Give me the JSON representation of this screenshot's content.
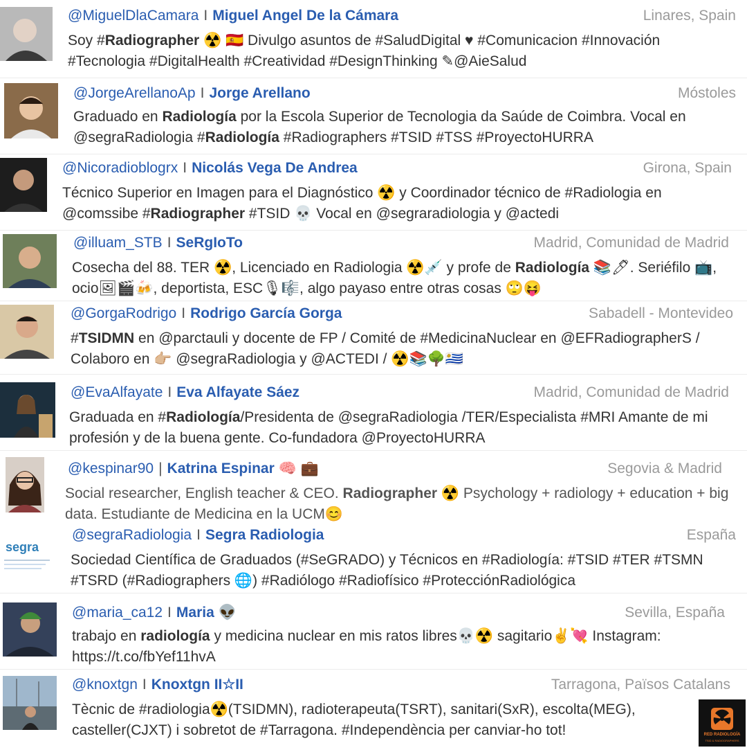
{
  "profiles": [
    {
      "handle": "@MiguelDlaCamara",
      "sep": "I",
      "name": "Miguel Angel De la Cámara",
      "name_suffix": "",
      "location": "Linares, Spain",
      "bio": [
        {
          "t": "Soy #"
        },
        {
          "b": "Radiographer"
        },
        {
          "t": " ☢️ 🇪🇸 Divulgo asuntos de #SaludDigital ♥ #Comunicacion #Innovación #Tecnologia #DigitalHealth #Creatividad #DesignThinking ✎@AieSalud"
        }
      ]
    },
    {
      "handle": "@JorgeArellanoAp",
      "sep": "I",
      "name": "Jorge Arellano",
      "name_suffix": "",
      "location": "Móstoles",
      "bio": [
        {
          "t": "Graduado en "
        },
        {
          "b": "Radiología"
        },
        {
          "t": " por la Escola Superior de Tecnologia da Saúde de Coimbra. Vocal en @segraRadiologia #"
        },
        {
          "b": "Radiología"
        },
        {
          "t": " #Radiographers #TSID #TSS #ProyectoHURRA"
        }
      ]
    },
    {
      "handle": "@Nicoradioblogrx",
      "sep": "I",
      "name": "Nicolás Vega De Andrea",
      "name_suffix": "",
      "location": "Girona, Spain",
      "bio": [
        {
          "t": "Técnico Superior en Imagen para el Diagnóstico ☢️ y Coordinador técnico de #Radiologia en @comssibe #"
        },
        {
          "b": "Radiographer"
        },
        {
          "t": " #TSID 💀 Vocal en @segraradiologia y @actedi"
        }
      ]
    },
    {
      "handle": "@illuam_STB",
      "sep": "I",
      "name": "SeRgIoTo",
      "name_suffix": "",
      "location": "Madrid, Comunidad de Madrid",
      "bio": [
        {
          "t": "Cosecha del 88. TER ☢️, Licenciado en Radiologia ☢️💉 y profe de "
        },
        {
          "b": "Radiología"
        },
        {
          "t": " 📚🖊. Seriéfilo 📺, ocio🖼🎬🍻, deportista, ESC🎙🎼, algo payaso entre otras cosas 🙄😝"
        }
      ]
    },
    {
      "handle": "@GorgaRodrigo",
      "sep": "I",
      "name": "Rodrigo García Gorga",
      "name_suffix": "",
      "location": "Sabadell - Montevideo",
      "bio": [
        {
          "t": "#"
        },
        {
          "b": "TSIDMN"
        },
        {
          "t": " en @parctauli y docente de FP / Comité de #MedicinaNuclear en @EFRadiographerS / Colaboro en 👉🏼 @segraRadiologia y @ACTEDI / ☢️📚🌳🇺🇾"
        }
      ]
    },
    {
      "handle": "@EvaAlfayate",
      "sep": "I",
      "name": "Eva Alfayate Sáez",
      "name_suffix": "",
      "location": "Madrid, Comunidad de Madrid",
      "bio": [
        {
          "t": "Graduada en #"
        },
        {
          "b": "Radiología"
        },
        {
          "t": "/Presidenta de @segraRadiologia /TER/Especialista #MRI Amante de mi profesión y de la buena gente. Co-fundadora @ProyectoHURRA"
        }
      ]
    },
    {
      "handle": "@kespinar90",
      "sep": "|",
      "name": "Katrina Espinar",
      "name_suffix": "🧠 💼",
      "location": "Segovia & Madrid",
      "bio": [
        {
          "t": "Social researcher, English teacher & CEO. "
        },
        {
          "b": "Radiographer"
        },
        {
          "t": " ☢️ Psychology + radiology + education + big data. Estudiante de Medicina en la UCM😊"
        }
      ]
    },
    {
      "handle": "@segraRadiologia",
      "sep": "I",
      "name": "Segra Radiologia",
      "name_suffix": "",
      "location": "España",
      "bio": [
        {
          "t": "Sociedad Científica de Graduados (#SeGRADO) y Técnicos en #Radiología: #TSID #TER #TSMN #TSRD (#Radiographers 🌐) #Radiólogo #Radiofísico #ProtecciónRadiológica"
        }
      ]
    },
    {
      "handle": "@maria_ca12",
      "sep": "I",
      "name": "Maria",
      "name_suffix": "👽",
      "location": "Sevilla, España",
      "bio": [
        {
          "t": "trabajo en "
        },
        {
          "b": "radiología"
        },
        {
          "t": " y medicina nuclear en mis ratos libres💀☢️ sagitario✌💘 Instagram: https://t.co/fbYef11hvA"
        }
      ]
    },
    {
      "handle": "@knoxtgn",
      "sep": "I",
      "name": "Knoxtgn II☆II",
      "name_suffix": "",
      "location": "Tarragona, Països Catalans",
      "bio": [
        {
          "t": "Tècnic de #radiologia☢️(TSIDMN), radioterapeuta(TSRT), sanitari(SxR), escolta(MEG), casteller(CJXT) i sobretot de #Tarragona. #Independència per canviar-ho tot!"
        }
      ]
    }
  ],
  "segra_logo_text": "segra",
  "watermark": {
    "line1": "RED RADIOLOGÍA",
    "line2": "TSID & RADIOGRAPHERS"
  },
  "colors": {
    "link": "#2a5db0",
    "location": "#9a9a9a",
    "text": "#333333"
  }
}
